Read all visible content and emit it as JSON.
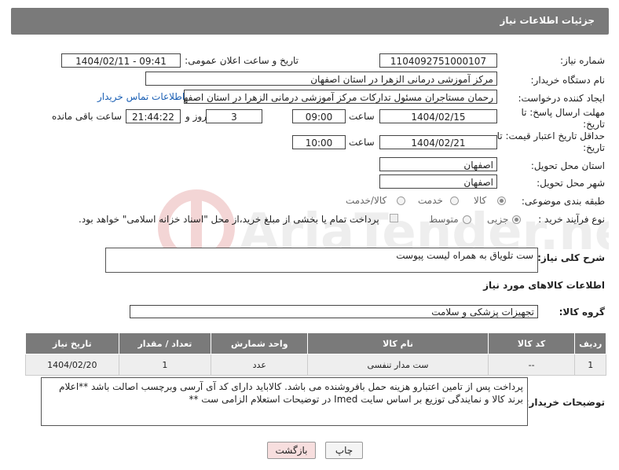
{
  "title": "جزئیات اطلاعات نیاز",
  "fields": {
    "need_number_label": "شماره نیاز:",
    "need_number": "1104092751000107",
    "announce_label": "تاریخ و ساعت اعلان عمومی:",
    "announce_value": "1404/02/11 - 09:41",
    "buyer_label": "نام دستگاه خریدار:",
    "buyer_value": "مرکز آموزشی درمانی الزهرا در استان اصفهان",
    "creator_label": "ایجاد کننده درخواست:",
    "creator_value": "رحمان مستاجران مسئول تدارکات مرکز آموزشی درمانی الزهرا در استان اصفهان",
    "contact_link": "اطلاعات تماس خریدار",
    "deadline_label": "مهلت ارسال پاسخ: تا تاریخ:",
    "deadline_date": "1404/02/15",
    "time_label": "ساعت",
    "deadline_time": "09:00",
    "days_value": "3",
    "days_label": "روز و",
    "remaining_time": "21:44:22",
    "remaining_label": "ساعت باقی مانده",
    "min_validity_label": "حداقل تاریخ اعتبار قیمت: تا تاریخ:",
    "validity_date": "1404/02/21",
    "time_label2": "ساعت",
    "validity_time": "10:00",
    "province_label": "استان محل تحویل:",
    "province_value": "اصفهان",
    "city_label": "شهر محل تحویل:",
    "city_value": "اصفهان",
    "category_label": "طبقه بندی موضوعی:",
    "category_options": [
      "کالا",
      "خدمت",
      "کالا/خدمت"
    ],
    "category_selected": "کالا",
    "process_label": "نوع فرآیند خرید :",
    "process_options": [
      "جزیی",
      "متوسط"
    ],
    "process_selected": "جزیی",
    "payment_note": "پرداخت تمام یا بخشی از مبلغ خرید،از محل \"اسناد خزانه اسلامی\" خواهد بود."
  },
  "description": {
    "label": "شرح کلی نیاز:",
    "value": "ست تلویاق به همراه لیست پیوست"
  },
  "goods_section": {
    "header": "اطلاعات کالاهای مورد نیاز",
    "group_label": "گروه کالا:",
    "group_value": "تجهیزات پزشکی و سلامت"
  },
  "table": {
    "headers": [
      "ردیف",
      "کد کالا",
      "نام کالا",
      "واحد شمارش",
      "تعداد / مقدار",
      "تاریخ نیاز"
    ],
    "rows": [
      [
        "1",
        "--",
        "ست مدار تنفسی",
        "عدد",
        "1",
        "1404/02/20"
      ]
    ]
  },
  "buyer_notes": {
    "label": "توضیحات خریدار:",
    "line1": "پرداخت پس از تامین اعتبارو هزینه حمل بافروشنده می باشد. کالاباید دارای کد آی آرسی وبرچسب اصالت باشد  **اعلام",
    "line2": "برند کالا و نمایندگی توزیع بر اساس سایت Imed در توضیحات استعلام الزامی ست **"
  },
  "buttons": {
    "print": "چاپ",
    "back": "بازگشت"
  },
  "watermark": "AriaTender.net",
  "colors": {
    "title_bar": "#7a7a7a",
    "link": "#1a5fb4",
    "back_button": "#f7dede"
  }
}
